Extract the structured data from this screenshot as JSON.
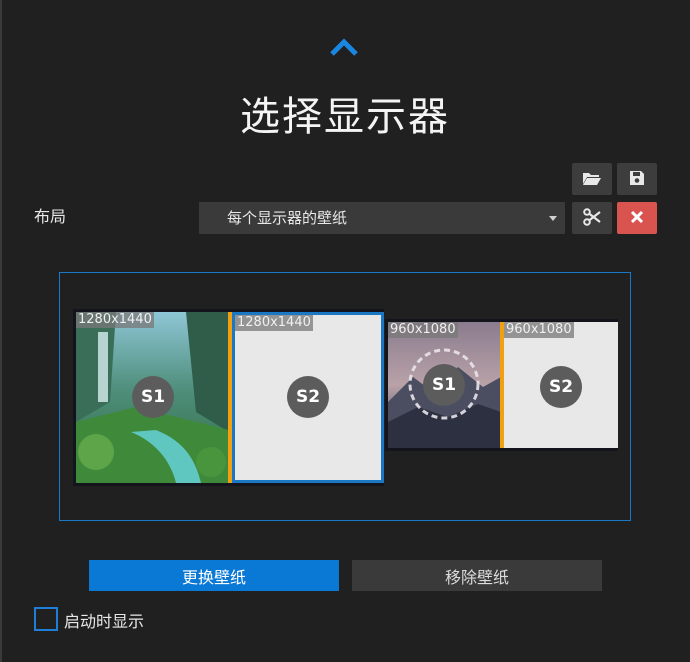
{
  "title": "选择显示器",
  "toolbar": {
    "open_icon": "folder-open-icon",
    "save_icon": "save-icon",
    "cut_icon": "scissors-icon",
    "close_icon": "close-icon"
  },
  "layout": {
    "label": "布局",
    "selected": "每个显示器的壁纸"
  },
  "monitors": [
    {
      "halves": [
        {
          "resolution": "1280x1440",
          "badge": "S1"
        },
        {
          "resolution": "1280x1440",
          "badge": "S2"
        }
      ]
    },
    {
      "halves": [
        {
          "resolution": "960x1080",
          "badge": "S1"
        },
        {
          "resolution": "960x1080",
          "badge": "S2"
        }
      ]
    }
  ],
  "actions": {
    "change": "更换壁纸",
    "remove": "移除壁纸"
  },
  "startup_checkbox": {
    "label": "启动时显示",
    "checked": false
  },
  "colors": {
    "accent": "#0a79d6",
    "divider": "#f0a011",
    "danger": "#d9534f"
  }
}
